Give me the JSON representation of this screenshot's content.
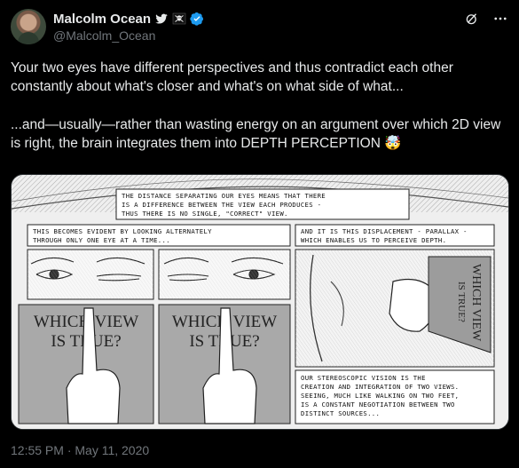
{
  "author": {
    "display_name": "Malcolm Ocean",
    "handle": "@Malcolm_Ocean"
  },
  "icons": [
    "twitter-bird-icon",
    "pirate-flag-icon",
    "verified-badge-icon",
    "grok-icon",
    "more-icon"
  ],
  "colors": {
    "verified": "#1d9bf0",
    "text": "#e7e9ea",
    "muted": "#71767b",
    "background": "#000000"
  },
  "tweet": {
    "paragraph_1": "Your two eyes have different perspectives and thus contradict each other constantly about what's closer and what's on what side of what...",
    "paragraph_2": "...and—usually—rather than wasting energy on an argument over which 2D view is right, the brain integrates them into DEPTH PERCEPTION 🤯",
    "timestamp": "12:55 PM · May 11, 2020"
  },
  "comic": {
    "caption_top_1": "THE DISTANCE SEPARATING OUR EYES MEANS THAT THERE",
    "caption_top_2": "IS A DIFFERENCE BETWEEN THE VIEW EACH PRODUCES -",
    "caption_top_3": "THUS THERE IS NO SINGLE, \"CORRECT\" VIEW.",
    "caption_left_1": "THIS BECOMES EVIDENT BY LOOKING ALTERNATELY",
    "caption_left_2": "THROUGH ONLY ONE EYE AT A TIME...",
    "caption_right_1": "AND IT IS THIS DISPLACEMENT - PARALLAX -",
    "caption_right_2": "WHICH ENABLES US TO PERCEIVE DEPTH.",
    "panel_left_line1": "WHICH VIEW",
    "panel_left_line2": "IS TRUE?",
    "panel_mid_line1": "WHICH VIEW",
    "panel_mid_line2": "IS TRUE?",
    "panel_side_line1": "WHICH VIEW",
    "panel_side_line2": "IS TRUE?",
    "caption_bottom_1": "OUR STEREOSCOPIC VISION IS THE",
    "caption_bottom_2": "CREATION AND INTEGRATION OF TWO VIEWS.",
    "caption_bottom_3": "SEEING, MUCH LIKE WALKING ON TWO FEET,",
    "caption_bottom_4": "IS A CONSTANT NEGOTIATION BETWEEN TWO",
    "caption_bottom_5": "DISTINCT SOURCES..."
  }
}
